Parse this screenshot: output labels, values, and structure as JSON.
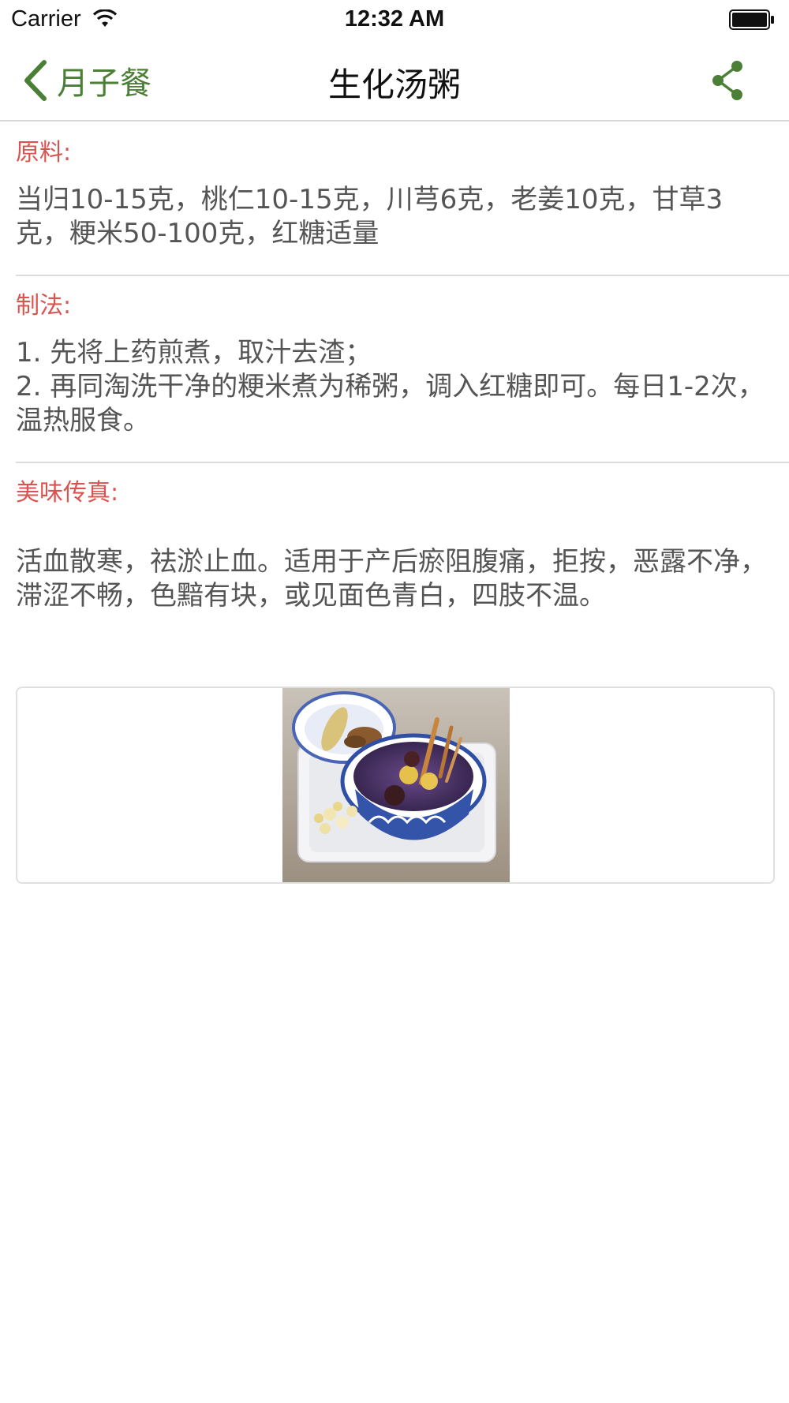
{
  "status_bar": {
    "carrier": "Carrier",
    "time": "12:32 AM",
    "wifi_icon": "wifi-icon",
    "battery_icon": "battery-icon"
  },
  "nav": {
    "back_label": "月子餐",
    "title": "生化汤粥",
    "back_icon": "chevron-left-icon",
    "share_icon": "share-icon",
    "accent_color": "#4a7f35"
  },
  "sections": [
    {
      "label": "原料:",
      "body": "当归10-15克，桃仁10-15克，川芎6克，老姜10克，甘草3克，粳米50-100克，红糖适量"
    },
    {
      "label": "制法:",
      "body": "1. 先将上药煎煮，取汁去渣；\n2. 再同淘洗干净的粳米煮为稀粥，调入红糖即可。每日1-2次，温热服食。"
    },
    {
      "label": "美味传真:",
      "body": "活血散寒，祛淤止血。适用于产后瘀阻腹痛，拒按，恶露不净，滞涩不畅，色黯有块，或见面色青白，四肢不温。"
    }
  ],
  "label_color": "#d9534f"
}
